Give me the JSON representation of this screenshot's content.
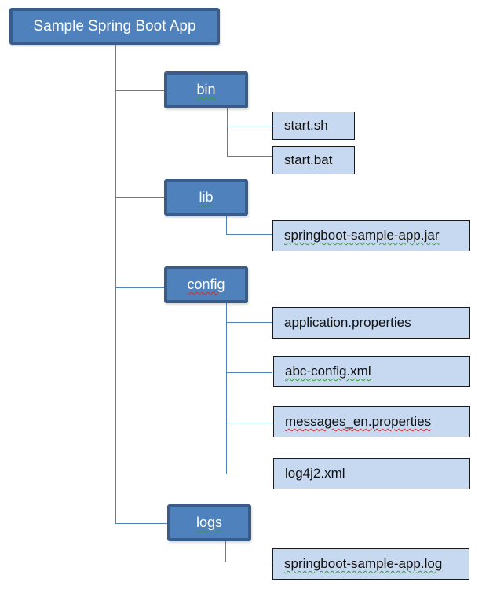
{
  "diagram": {
    "root": {
      "label": "Sample Spring Boot App"
    },
    "folders": [
      {
        "label": "bin",
        "spellcheck": "grammar",
        "files": [
          {
            "label": "start.sh",
            "spellcheck": "none"
          },
          {
            "label": "start.bat",
            "spellcheck": "none"
          }
        ]
      },
      {
        "label": "lib",
        "spellcheck": "grammar",
        "files": [
          {
            "label": "springboot-sample-app.jar",
            "spellcheck": "grammar"
          }
        ]
      },
      {
        "label": "config",
        "spellcheck": "spelling",
        "files": [
          {
            "label": "application.properties",
            "spellcheck": "none"
          },
          {
            "label": "abc-config.xml",
            "spellcheck": "grammar"
          },
          {
            "label": "messages_en.properties",
            "spellcheck": "spelling"
          },
          {
            "label": "log4j2.xml",
            "spellcheck": "none"
          }
        ]
      },
      {
        "label": "logs",
        "spellcheck": "grammar",
        "files": [
          {
            "label": "springboot-sample-app.log",
            "spellcheck": "grammar"
          }
        ]
      }
    ],
    "colors": {
      "folder_fill": "#4f81bd",
      "folder_border": "#385d8a",
      "file_fill": "#c6d9f1",
      "connector": "#4f81bd"
    }
  }
}
